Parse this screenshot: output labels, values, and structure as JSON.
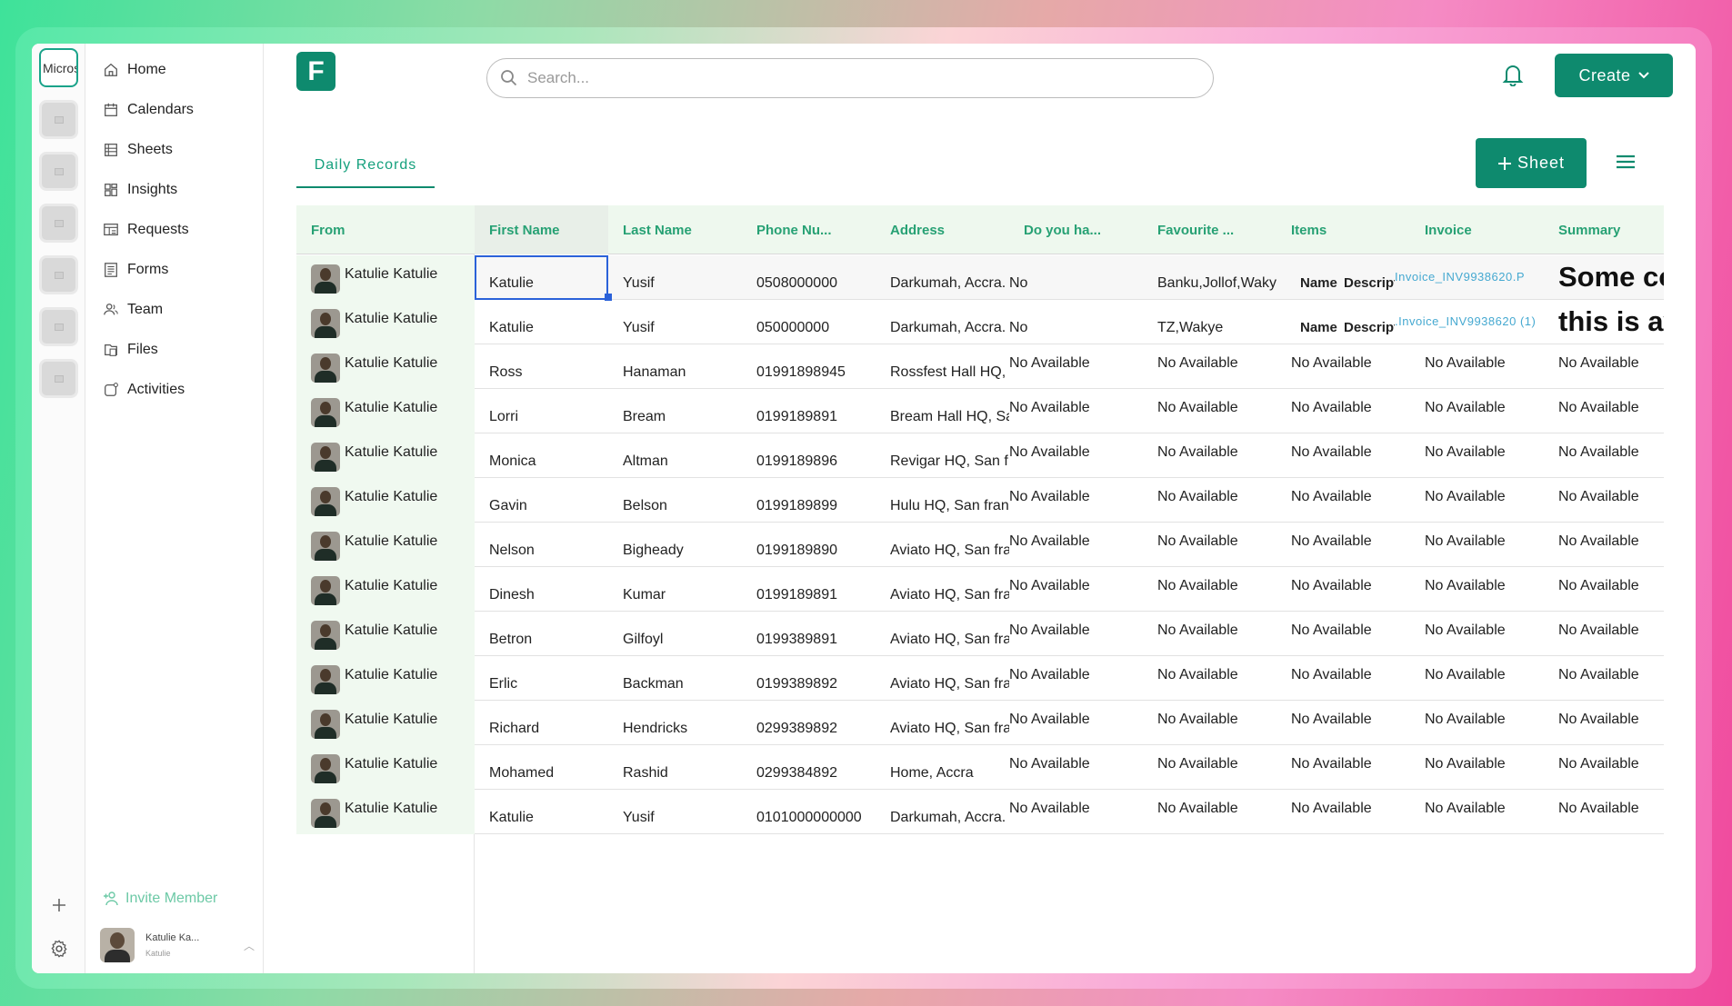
{
  "workspace": {
    "active_label": "Microsoft",
    "thumb_count": 6
  },
  "nav": {
    "items": [
      {
        "label": "Home",
        "icon": "home-icon"
      },
      {
        "label": "Calendars",
        "icon": "calendar-icon"
      },
      {
        "label": "Sheets",
        "icon": "sheets-icon"
      },
      {
        "label": "Insights",
        "icon": "insights-icon"
      },
      {
        "label": "Requests",
        "icon": "requests-icon"
      },
      {
        "label": "Forms",
        "icon": "forms-icon"
      },
      {
        "label": "Team",
        "icon": "team-icon"
      },
      {
        "label": "Files",
        "icon": "files-icon"
      },
      {
        "label": "Activities",
        "icon": "activities-icon"
      }
    ],
    "invite_label": "Invite Member",
    "user": {
      "name": "Katulie Ka...",
      "sub": "Katulie"
    }
  },
  "header": {
    "logo_letter": "F",
    "search_placeholder": "Search...",
    "create_label": "Create"
  },
  "toolbar": {
    "tab_label": "Daily Records",
    "sheet_button": "Sheet"
  },
  "table": {
    "columns": [
      "From",
      "First Name",
      "Last Name",
      "Phone Nu...",
      "Address",
      "Do you ha...",
      "Favourite ...",
      "Items",
      "Invoice",
      "Summary"
    ],
    "rows": [
      {
        "from": "Katulie Katulie",
        "first": "Katulie",
        "last": "Yusif",
        "phone": "0508000000",
        "address": "Darkumah, Accra.",
        "doyou": "No",
        "fav": "Banku,Jollof,Waky",
        "items_a": "Name",
        "items_b": "Description",
        "invoice": "Invoice_INV9938620.P",
        "summary": "Some content"
      },
      {
        "from": "Katulie Katulie",
        "first": "Katulie",
        "last": "Yusif",
        "phone": "050000000",
        "address": "Darkumah, Accra.",
        "doyou": "No",
        "fav": "TZ,Wakye",
        "items_a": "Name",
        "items_b": "Description",
        "invoice": "Invoice_INV9938620 (1).",
        "summary": "this is available"
      },
      {
        "from": "Katulie Katulie",
        "first": "Ross",
        "last": "Hanaman",
        "phone": "01991898945",
        "address": "Rossfest Hall HQ, San",
        "doyou": "No Available",
        "fav": "No Available",
        "items": "No Available",
        "invoice": "No Available",
        "summary": "No Available"
      },
      {
        "from": "Katulie Katulie",
        "first": "Lorri",
        "last": "Bream",
        "phone": "0199189891",
        "address": "Bream Hall HQ, San",
        "doyou": "No Available",
        "fav": "No Available",
        "items": "No Available",
        "invoice": "No Available",
        "summary": "No Available"
      },
      {
        "from": "Katulie Katulie",
        "first": "Monica",
        "last": "Altman",
        "phone": "0199189896",
        "address": "Revigar HQ, San fran",
        "doyou": "No Available",
        "fav": "No Available",
        "items": "No Available",
        "invoice": "No Available",
        "summary": "No Available"
      },
      {
        "from": "Katulie Katulie",
        "first": "Gavin",
        "last": "Belson",
        "phone": "0199189899",
        "address": "Hulu HQ, San francisco",
        "doyou": "No Available",
        "fav": "No Available",
        "items": "No Available",
        "invoice": "No Available",
        "summary": "No Available"
      },
      {
        "from": "Katulie Katulie",
        "first": "Nelson",
        "last": "Bigheady",
        "phone": "0199189890",
        "address": "Aviato HQ, San fran",
        "doyou": "No Available",
        "fav": "No Available",
        "items": "No Available",
        "invoice": "No Available",
        "summary": "No Available"
      },
      {
        "from": "Katulie Katulie",
        "first": "Dinesh",
        "last": "Kumar",
        "phone": "0199189891",
        "address": "Aviato HQ, San fran",
        "doyou": "No Available",
        "fav": "No Available",
        "items": "No Available",
        "invoice": "No Available",
        "summary": "No Available"
      },
      {
        "from": "Katulie Katulie",
        "first": "Betron",
        "last": "Gilfoyl",
        "phone": "0199389891",
        "address": "Aviato HQ, San fran",
        "doyou": "No Available",
        "fav": "No Available",
        "items": "No Available",
        "invoice": "No Available",
        "summary": "No Available"
      },
      {
        "from": "Katulie Katulie",
        "first": "Erlic",
        "last": "Backman",
        "phone": "0199389892",
        "address": "Aviato HQ, San fran",
        "doyou": "No Available",
        "fav": "No Available",
        "items": "No Available",
        "invoice": "No Available",
        "summary": "No Available"
      },
      {
        "from": "Katulie Katulie",
        "first": "Richard",
        "last": "Hendricks",
        "phone": "0299389892",
        "address": "Aviato HQ, San fran",
        "doyou": "No Available",
        "fav": "No Available",
        "items": "No Available",
        "invoice": "No Available",
        "summary": "No Available"
      },
      {
        "from": "Katulie Katulie",
        "first": "Mohamed",
        "last": "Rashid",
        "phone": "0299384892",
        "address": "Home, Accra",
        "doyou": "No Available",
        "fav": "No Available",
        "items": "No Available",
        "invoice": "No Available",
        "summary": "No Available"
      },
      {
        "from": "Katulie Katulie",
        "first": "Katulie",
        "last": "Yusif",
        "phone": "0101000000000",
        "address": "Darkumah, Accra.",
        "doyou": "No Available",
        "fav": "No Available",
        "items": "No Available",
        "invoice": "No Available",
        "summary": "No Available"
      }
    ]
  },
  "colors": {
    "brand": "#0e8a6e",
    "header_text": "#27a174",
    "selection": "#2b62d9"
  }
}
